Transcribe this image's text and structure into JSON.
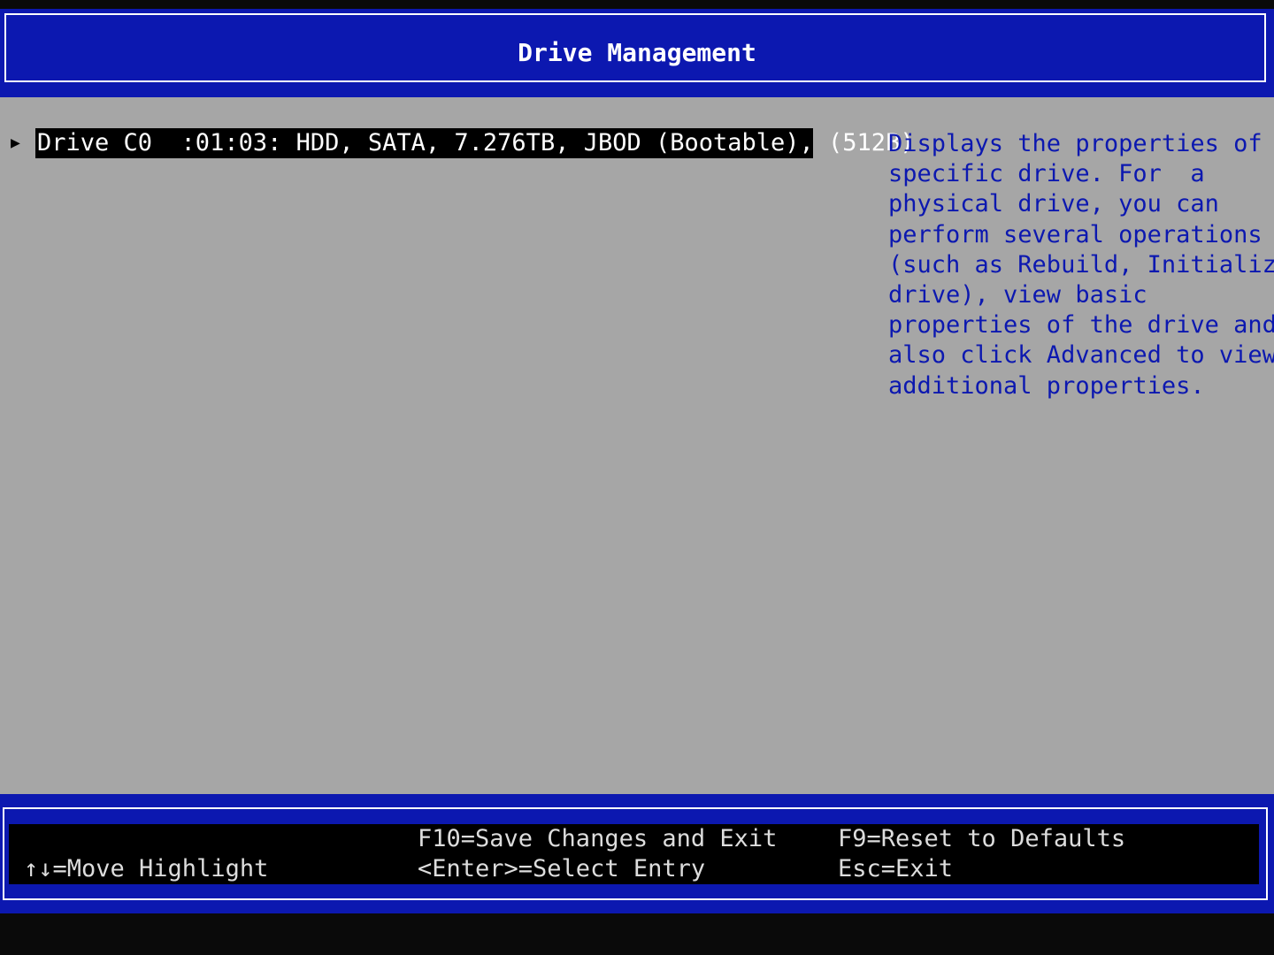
{
  "header": {
    "title": "Drive Management"
  },
  "drive_list": {
    "pointer": "▶",
    "items": [
      {
        "label": "Drive C0  :01:03: HDD, SATA, 7.276TB, JBOD (Bootable), (512B)"
      }
    ]
  },
  "help": {
    "lines": [
      "Displays the properties of a",
      "specific drive. For  a",
      "physical drive, you can",
      "perform several operations",
      "(such as Rebuild, Initialize",
      "drive), view basic",
      "properties of the drive and",
      "also click Advanced to view",
      "additional properties."
    ]
  },
  "footer": {
    "move_highlight": "↑↓=Move Highlight",
    "save_exit": "F10=Save Changes and Exit",
    "select_entry": "<Enter>=Select Entry",
    "reset_defaults": "F9=Reset to Defaults",
    "esc_exit": "Esc=Exit"
  },
  "colors": {
    "header_blue": "#0c18b0",
    "panel_gray": "#a6a6a6",
    "help_text": "#0c18b0",
    "highlight_bg": "#000000",
    "highlight_fg": "#ffffff"
  }
}
